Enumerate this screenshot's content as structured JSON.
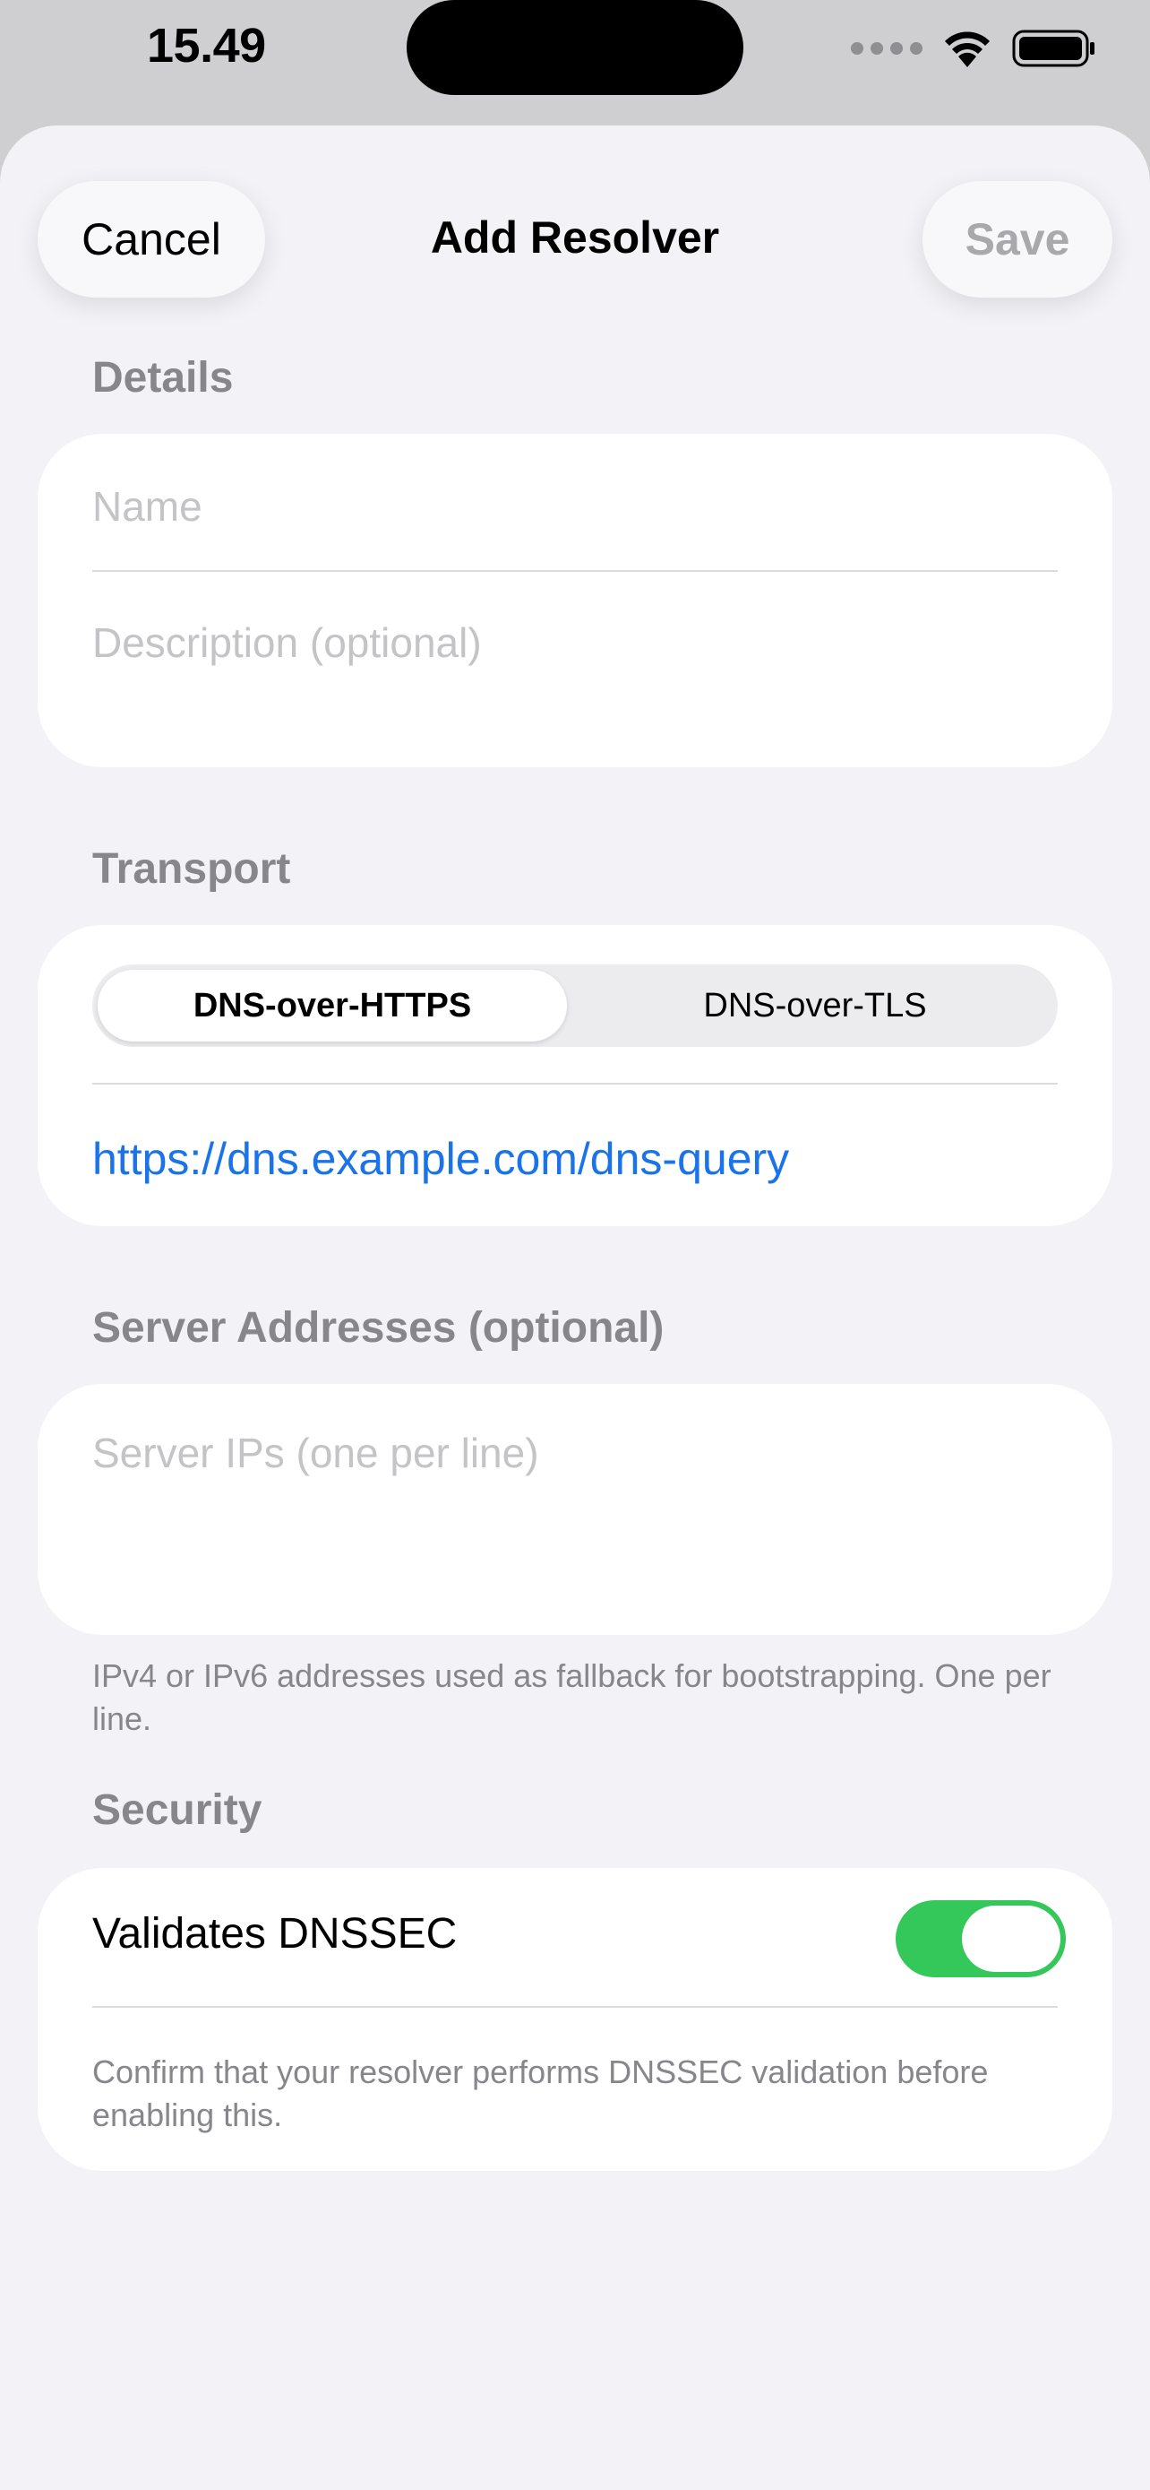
{
  "status_bar": {
    "time": "15.49",
    "icons": [
      "signal-dots-icon",
      "wifi-icon",
      "battery-icon"
    ]
  },
  "nav": {
    "cancel_label": "Cancel",
    "title": "Add Resolver",
    "save_label": "Save"
  },
  "details": {
    "header": "Details",
    "name_placeholder": "Name",
    "description_placeholder": "Description (optional)"
  },
  "transport": {
    "header": "Transport",
    "options": [
      "DNS-over-HTTPS",
      "DNS-over-TLS"
    ],
    "selected": "DNS-over-HTTPS",
    "url_value": "https://dns.example.com/dns-query"
  },
  "servers": {
    "header": "Server Addresses (optional)",
    "placeholder": "Server IPs (one per line)",
    "footer": "IPv4 or IPv6 addresses used as fallback for bootstrapping. One per line."
  },
  "security": {
    "header": "Security",
    "toggle_label": "Validates DNSSEC",
    "toggle_on": true,
    "note": "Confirm that your resolver performs DNSSEC validation before enabling this."
  },
  "colors": {
    "accent": "#1a73e8",
    "toggle_on": "#34c759",
    "background": "#f2f2f7"
  }
}
